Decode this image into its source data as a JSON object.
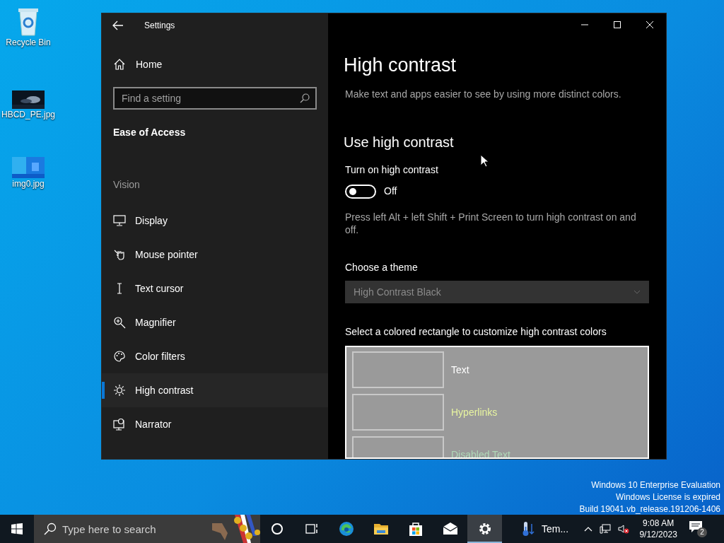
{
  "desktop": {
    "icons": [
      {
        "label": "Recycle Bin",
        "kind": "bin"
      },
      {
        "label": "HBCD_PE.jpg",
        "kind": "dark"
      },
      {
        "label": "img0.jpg",
        "kind": "blue"
      }
    ],
    "system_notice": [
      "Windows 10 Enterprise Evaluation",
      "Windows License is expired",
      "Build 19041.vb_release.191206-1406"
    ]
  },
  "window": {
    "title": "Settings",
    "sidebar": {
      "home": "Home",
      "search": {
        "placeholder": "Find a setting"
      },
      "section": "Ease of Access",
      "group": "Vision",
      "items": [
        {
          "label": "Display",
          "selected": false
        },
        {
          "label": "Mouse pointer",
          "selected": false
        },
        {
          "label": "Text cursor",
          "selected": false
        },
        {
          "label": "Magnifier",
          "selected": false
        },
        {
          "label": "Color filters",
          "selected": false
        },
        {
          "label": "High contrast",
          "selected": true
        },
        {
          "label": "Narrator",
          "selected": false
        }
      ]
    },
    "content": {
      "title": "High contrast",
      "description": "Make text and apps easier to see by using more distinct colors.",
      "subheading": "Use high contrast",
      "toggle": {
        "label": "Turn on high contrast",
        "on": false,
        "state_text": "Off"
      },
      "hint": "Press left Alt + left Shift + Print Screen to turn high contrast on and off.",
      "theme_label": "Choose a theme",
      "theme_select": {
        "value": "High Contrast Black",
        "disabled": true
      },
      "colors_label": "Select a colored rectangle to customize high contrast colors",
      "color_items": [
        {
          "label": "Text",
          "color": "#ffffff"
        },
        {
          "label": "Hyperlinks",
          "color": "#e8f5a0"
        },
        {
          "label": "Disabled Text",
          "color": "#b0d8b8"
        }
      ]
    }
  },
  "taskbar": {
    "search": {
      "placeholder": "Type here to search"
    },
    "apps": [
      {
        "kind": "cortana",
        "selected": false
      },
      {
        "kind": "taskview",
        "selected": false
      },
      {
        "kind": "edge",
        "selected": false
      },
      {
        "kind": "explorer",
        "selected": false
      },
      {
        "kind": "store",
        "selected": false
      },
      {
        "kind": "mail",
        "selected": false
      },
      {
        "kind": "settings",
        "selected": true
      }
    ],
    "weather": "Tem...",
    "time": "9:08 AM",
    "date": "9/12/2023",
    "notifications": "2"
  }
}
